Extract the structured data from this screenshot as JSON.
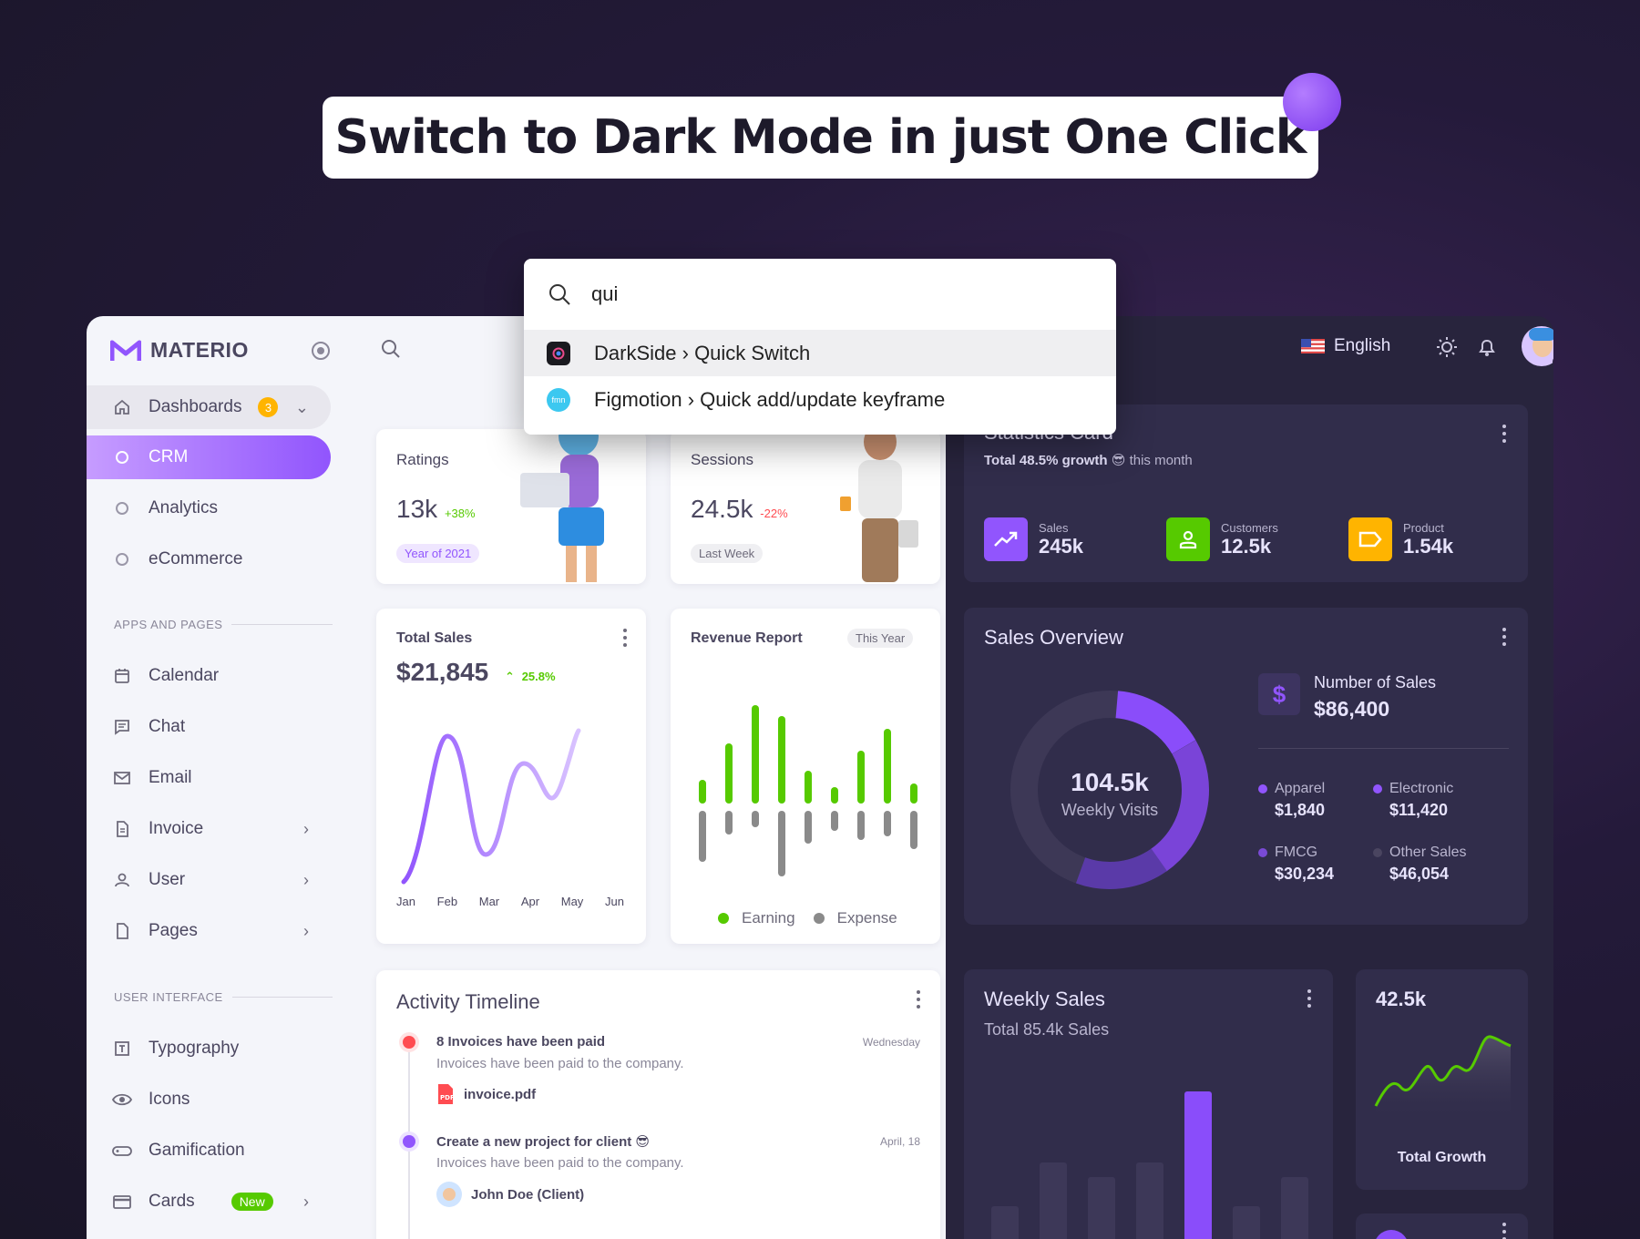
{
  "banner": {
    "title": "Switch to Dark Mode in just One Click"
  },
  "colors": {
    "primary": "#9155fd",
    "success": "#56ca00",
    "warning": "#ffb400",
    "error": "#ff4c51",
    "dark_bg": "#28243d",
    "dark_card": "#312d4b"
  },
  "palette": {
    "query": "qui",
    "results": [
      {
        "app": "DarkSide",
        "sep": "›",
        "action": "Quick Switch",
        "icon": "darkside-icon"
      },
      {
        "app": "Figmotion",
        "sep": "›",
        "action": "Quick add/update keyframe",
        "icon": "figmotion-icon"
      }
    ]
  },
  "brand": {
    "name": "MATERIO"
  },
  "sidebar": {
    "dashboards": {
      "label": "Dashboards",
      "badge": "3"
    },
    "sub": [
      {
        "label": "CRM"
      },
      {
        "label": "Analytics"
      },
      {
        "label": "eCommerce"
      }
    ],
    "section_apps": "APPS AND PAGES",
    "apps": [
      {
        "label": "Calendar",
        "icon": "calendar-icon"
      },
      {
        "label": "Chat",
        "icon": "chat-icon"
      },
      {
        "label": "Email",
        "icon": "email-icon"
      },
      {
        "label": "Invoice",
        "icon": "invoice-icon"
      },
      {
        "label": "User",
        "icon": "user-icon"
      },
      {
        "label": "Pages",
        "icon": "pages-icon"
      }
    ],
    "section_ui": "USER INTERFACE",
    "ui": [
      {
        "label": "Typography",
        "icon": "typography-icon"
      },
      {
        "label": "Icons",
        "icon": "eye-icon"
      },
      {
        "label": "Gamification",
        "icon": "gamepad-icon"
      },
      {
        "label": "Cards",
        "icon": "card-icon",
        "badge": "New"
      }
    ]
  },
  "header": {
    "language": "English"
  },
  "ratings": {
    "title": "Ratings",
    "value": "13k",
    "change": "+38%",
    "chip": "Year of 2021"
  },
  "sessions": {
    "title": "Sessions",
    "value": "24.5k",
    "change": "-22%",
    "chip": "Last Week"
  },
  "total_sales": {
    "title": "Total Sales",
    "value": "$21,845",
    "change": "25.8%",
    "months": [
      "Jan",
      "Feb",
      "Mar",
      "Apr",
      "May",
      "Jun"
    ]
  },
  "revenue": {
    "title": "Revenue Report",
    "chip": "This Year",
    "legend": [
      "Earning",
      "Expense"
    ]
  },
  "activity": {
    "title": "Activity Timeline",
    "items": [
      {
        "title": "8 Invoices have been paid",
        "desc": "Invoices have been paid to the company.",
        "time": "Wednesday",
        "attachment": "invoice.pdf",
        "color": "#ff4c51"
      },
      {
        "title": "Create a new project for client 😎",
        "desc": "Invoices have been paid to the company.",
        "time": "April, 18",
        "attachment": "John Doe (Client)",
        "color": "#9155fd"
      }
    ]
  },
  "statistics": {
    "title": "Statistics Card",
    "subtitle_pre": "Total 48.5% growth",
    "subtitle_emoji": "😎",
    "subtitle_post": "this month",
    "items": [
      {
        "label": "Sales",
        "value": "245k",
        "color": "#9155fd",
        "icon": "trending-up-icon"
      },
      {
        "label": "Customers",
        "value": "12.5k",
        "color": "#56ca00",
        "icon": "account-icon"
      },
      {
        "label": "Product",
        "value": "1.54k",
        "color": "#ffb400",
        "icon": "label-icon"
      }
    ]
  },
  "sales_overview": {
    "title": "Sales Overview",
    "center_value": "104.5k",
    "center_label": "Weekly Visits",
    "number_label": "Number of Sales",
    "number_value": "$86,400",
    "legend": [
      {
        "label": "Apparel",
        "value": "$1,840",
        "color": "#9155fd"
      },
      {
        "label": "Electronic",
        "value": "$11,420",
        "color": "#9155fd"
      },
      {
        "label": "FMCG",
        "value": "$30,234",
        "color": "#7a4ad6"
      },
      {
        "label": "Other Sales",
        "value": "$46,054",
        "color": "#4a4560"
      }
    ]
  },
  "weekly_sales": {
    "title": "Weekly Sales",
    "subtitle": "Total 85.4k Sales"
  },
  "total_growth": {
    "value": "42.5k",
    "label": "Total Growth"
  }
}
